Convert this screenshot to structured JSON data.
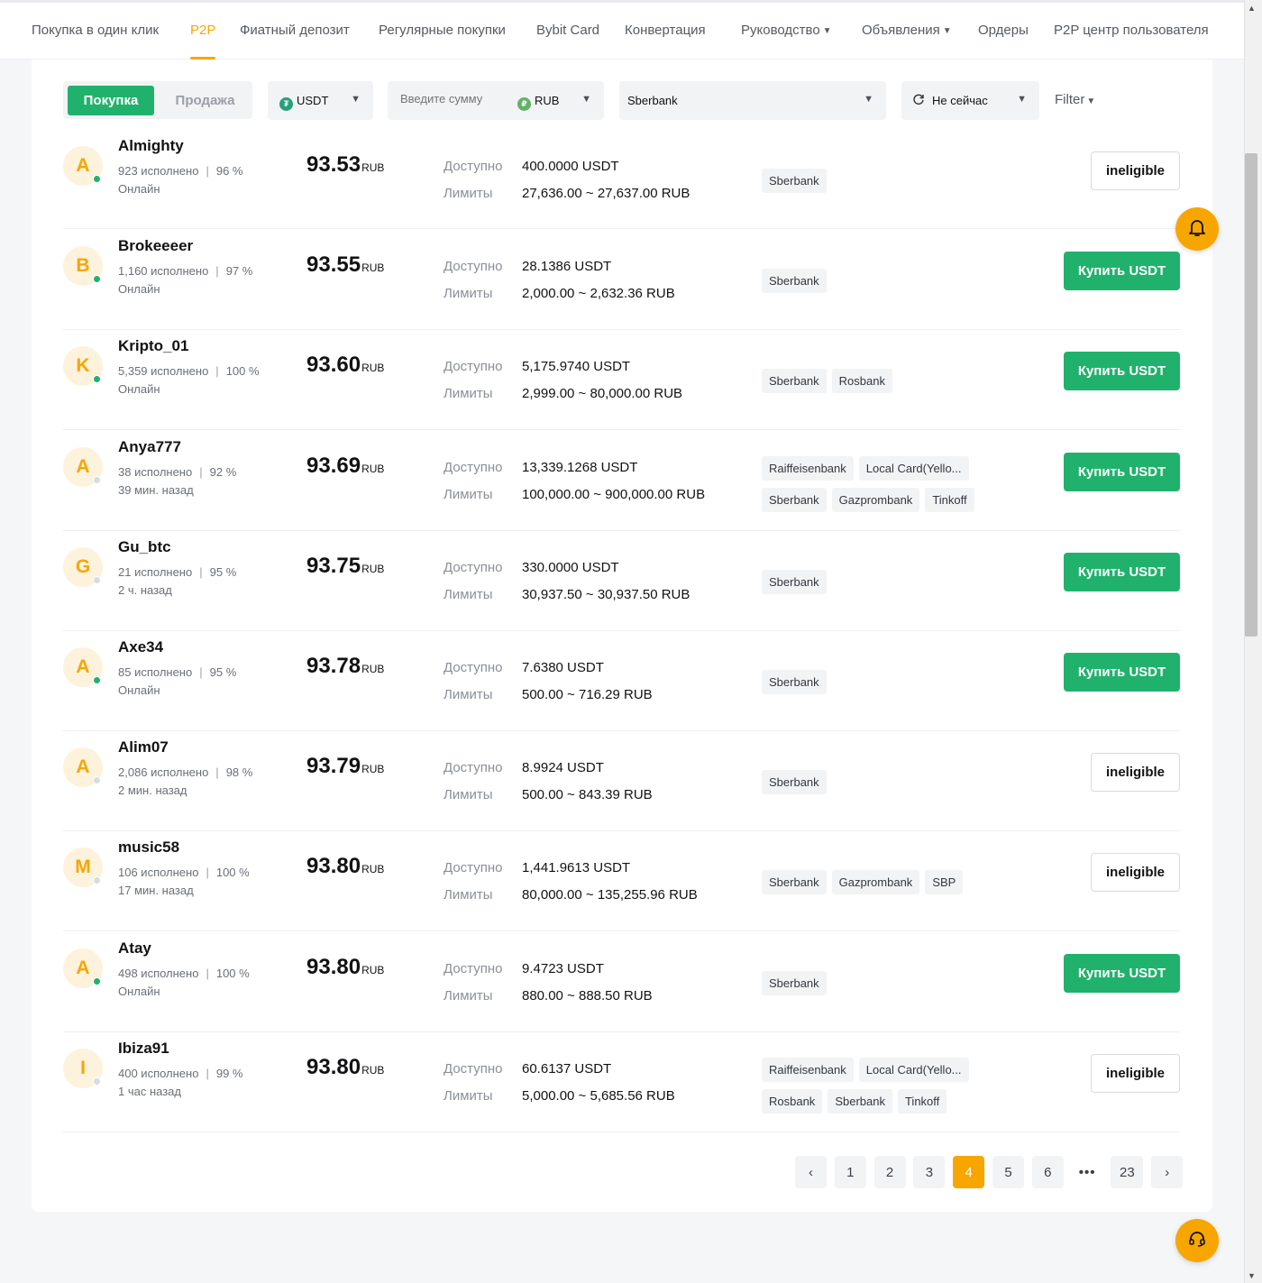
{
  "nav": {
    "items": [
      {
        "label": "Покупка в один клик"
      },
      {
        "label": "P2P"
      },
      {
        "label": "Фиатный депозит"
      },
      {
        "label": "Регулярные покупки"
      },
      {
        "label": "Bybit Card"
      },
      {
        "label": "Конвертация"
      },
      {
        "label": "Руководство"
      },
      {
        "label": "Объявления"
      },
      {
        "label": "Ордеры"
      },
      {
        "label": "P2P центр пользователя"
      }
    ],
    "active": "P2P"
  },
  "filters": {
    "buy_label": "Покупка",
    "sell_label": "Продажа",
    "coin": "USDT",
    "amount_placeholder": "Введите сумму",
    "fiat": "RUB",
    "payment": "Sberbank",
    "refresh": "Не сейчас",
    "filter_label": "Filter"
  },
  "offers": [
    {
      "avatar": "A",
      "name": "Almighty",
      "orders": "923 исполнено",
      "rate": "96 %",
      "status": "Онлайн",
      "online": true,
      "price": "93.53",
      "currency": "RUB",
      "available_label": "Доступно",
      "available": "400.0000 USDT",
      "limits_label": "Лимиты",
      "limits": "27,636.00 ~ 27,637.00 RUB",
      "payments": [
        "Sberbank"
      ],
      "action": "ineligible",
      "eligible": false
    },
    {
      "avatar": "B",
      "name": "Brokeeeer",
      "orders": "1,160 исполнено",
      "rate": "97 %",
      "status": "Онлайн",
      "online": true,
      "price": "93.55",
      "currency": "RUB",
      "available_label": "Доступно",
      "available": "28.1386 USDT",
      "limits_label": "Лимиты",
      "limits": "2,000.00 ~ 2,632.36 RUB",
      "payments": [
        "Sberbank"
      ],
      "action": "Купить USDT",
      "eligible": true
    },
    {
      "avatar": "K",
      "name": "Kripto_01",
      "orders": "5,359 исполнено",
      "rate": "100 %",
      "status": "Онлайн",
      "online": true,
      "price": "93.60",
      "currency": "RUB",
      "available_label": "Доступно",
      "available": "5,175.9740 USDT",
      "limits_label": "Лимиты",
      "limits": "2,999.00 ~ 80,000.00 RUB",
      "payments": [
        "Sberbank",
        "Rosbank"
      ],
      "action": "Купить USDT",
      "eligible": true
    },
    {
      "avatar": "A",
      "name": "Anya777",
      "orders": "38 исполнено",
      "rate": "92 %",
      "status": "39 мин. назад",
      "online": false,
      "price": "93.69",
      "currency": "RUB",
      "available_label": "Доступно",
      "available": "13,339.1268 USDT",
      "limits_label": "Лимиты",
      "limits": "100,000.00 ~ 900,000.00 RUB",
      "payments": [
        "Raiffeisenbank",
        "Local Card(Yello...",
        "Sberbank",
        "Gazprombank",
        "Tinkoff"
      ],
      "action": "Купить USDT",
      "eligible": true
    },
    {
      "avatar": "G",
      "name": "Gu_btc",
      "orders": "21 исполнено",
      "rate": "95 %",
      "status": "2 ч. назад",
      "online": false,
      "price": "93.75",
      "currency": "RUB",
      "available_label": "Доступно",
      "available": "330.0000 USDT",
      "limits_label": "Лимиты",
      "limits": "30,937.50 ~ 30,937.50 RUB",
      "payments": [
        "Sberbank"
      ],
      "action": "Купить USDT",
      "eligible": true
    },
    {
      "avatar": "A",
      "name": "Axe34",
      "orders": "85 исполнено",
      "rate": "95 %",
      "status": "Онлайн",
      "online": true,
      "price": "93.78",
      "currency": "RUB",
      "available_label": "Доступно",
      "available": "7.6380 USDT",
      "limits_label": "Лимиты",
      "limits": "500.00 ~ 716.29 RUB",
      "payments": [
        "Sberbank"
      ],
      "action": "Купить USDT",
      "eligible": true
    },
    {
      "avatar": "A",
      "name": "Alim07",
      "orders": "2,086 исполнено",
      "rate": "98 %",
      "status": "2 мин. назад",
      "online": false,
      "price": "93.79",
      "currency": "RUB",
      "available_label": "Доступно",
      "available": "8.9924 USDT",
      "limits_label": "Лимиты",
      "limits": "500.00 ~ 843.39 RUB",
      "payments": [
        "Sberbank"
      ],
      "action": "ineligible",
      "eligible": false
    },
    {
      "avatar": "M",
      "name": "music58",
      "orders": "106 исполнено",
      "rate": "100 %",
      "status": "17 мин. назад",
      "online": false,
      "price": "93.80",
      "currency": "RUB",
      "available_label": "Доступно",
      "available": "1,441.9613 USDT",
      "limits_label": "Лимиты",
      "limits": "80,000.00 ~ 135,255.96 RUB",
      "payments": [
        "Sberbank",
        "Gazprombank",
        "SBP"
      ],
      "action": "ineligible",
      "eligible": false
    },
    {
      "avatar": "A",
      "name": "Atay",
      "orders": "498 исполнено",
      "rate": "100 %",
      "status": "Онлайн",
      "online": true,
      "price": "93.80",
      "currency": "RUB",
      "available_label": "Доступно",
      "available": "9.4723 USDT",
      "limits_label": "Лимиты",
      "limits": "880.00 ~ 888.50 RUB",
      "payments": [
        "Sberbank"
      ],
      "action": "Купить USDT",
      "eligible": true
    },
    {
      "avatar": "I",
      "name": "Ibiza91",
      "orders": "400 исполнено",
      "rate": "99 %",
      "status": "1 час назад",
      "online": false,
      "price": "93.80",
      "currency": "RUB",
      "available_label": "Доступно",
      "available": "60.6137 USDT",
      "limits_label": "Лимиты",
      "limits": "5,000.00 ~ 5,685.56 RUB",
      "payments": [
        "Raiffeisenbank",
        "Local Card(Yello...",
        "Rosbank",
        "Sberbank",
        "Tinkoff"
      ],
      "action": "ineligible",
      "eligible": false
    }
  ],
  "pagination": {
    "prev": "‹",
    "pages": [
      "1",
      "2",
      "3",
      "4",
      "5",
      "6",
      "•••",
      "23"
    ],
    "current": "4",
    "next": "›"
  },
  "colors": {
    "accent": "#f7a600",
    "buy": "#20b26c"
  },
  "icons": {
    "bell": "bell-icon",
    "support": "headset-icon"
  }
}
